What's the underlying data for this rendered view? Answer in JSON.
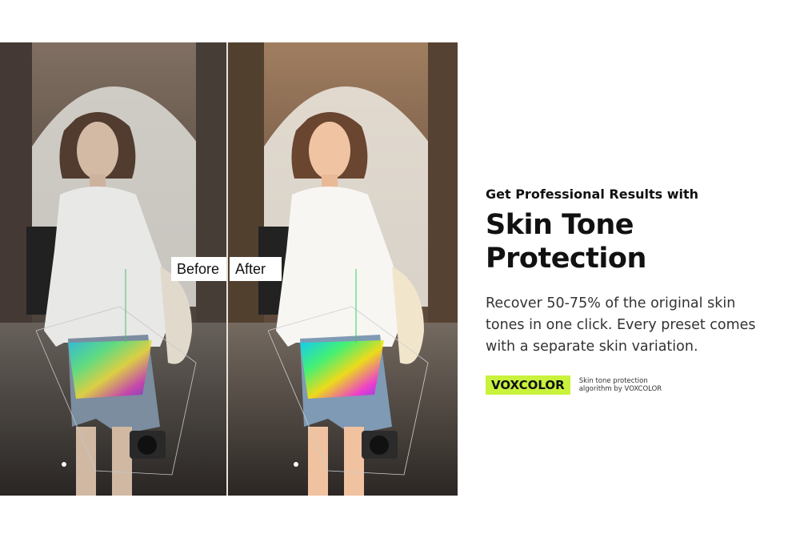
{
  "comparison": {
    "before_label": "Before",
    "after_label": "After"
  },
  "copy": {
    "subtitle": "Get Professional Results with",
    "headline": "Skin Tone Protection",
    "body": "Recover 50-75% of the original skin tones in one click.  Every preset comes with a separate skin variation."
  },
  "brand": {
    "name": "VOXCOLOR",
    "caption": "Skin tone protection algorithm by VOXCOLOR"
  },
  "colors": {
    "badge": "#c8f23c",
    "text": "#111111"
  }
}
